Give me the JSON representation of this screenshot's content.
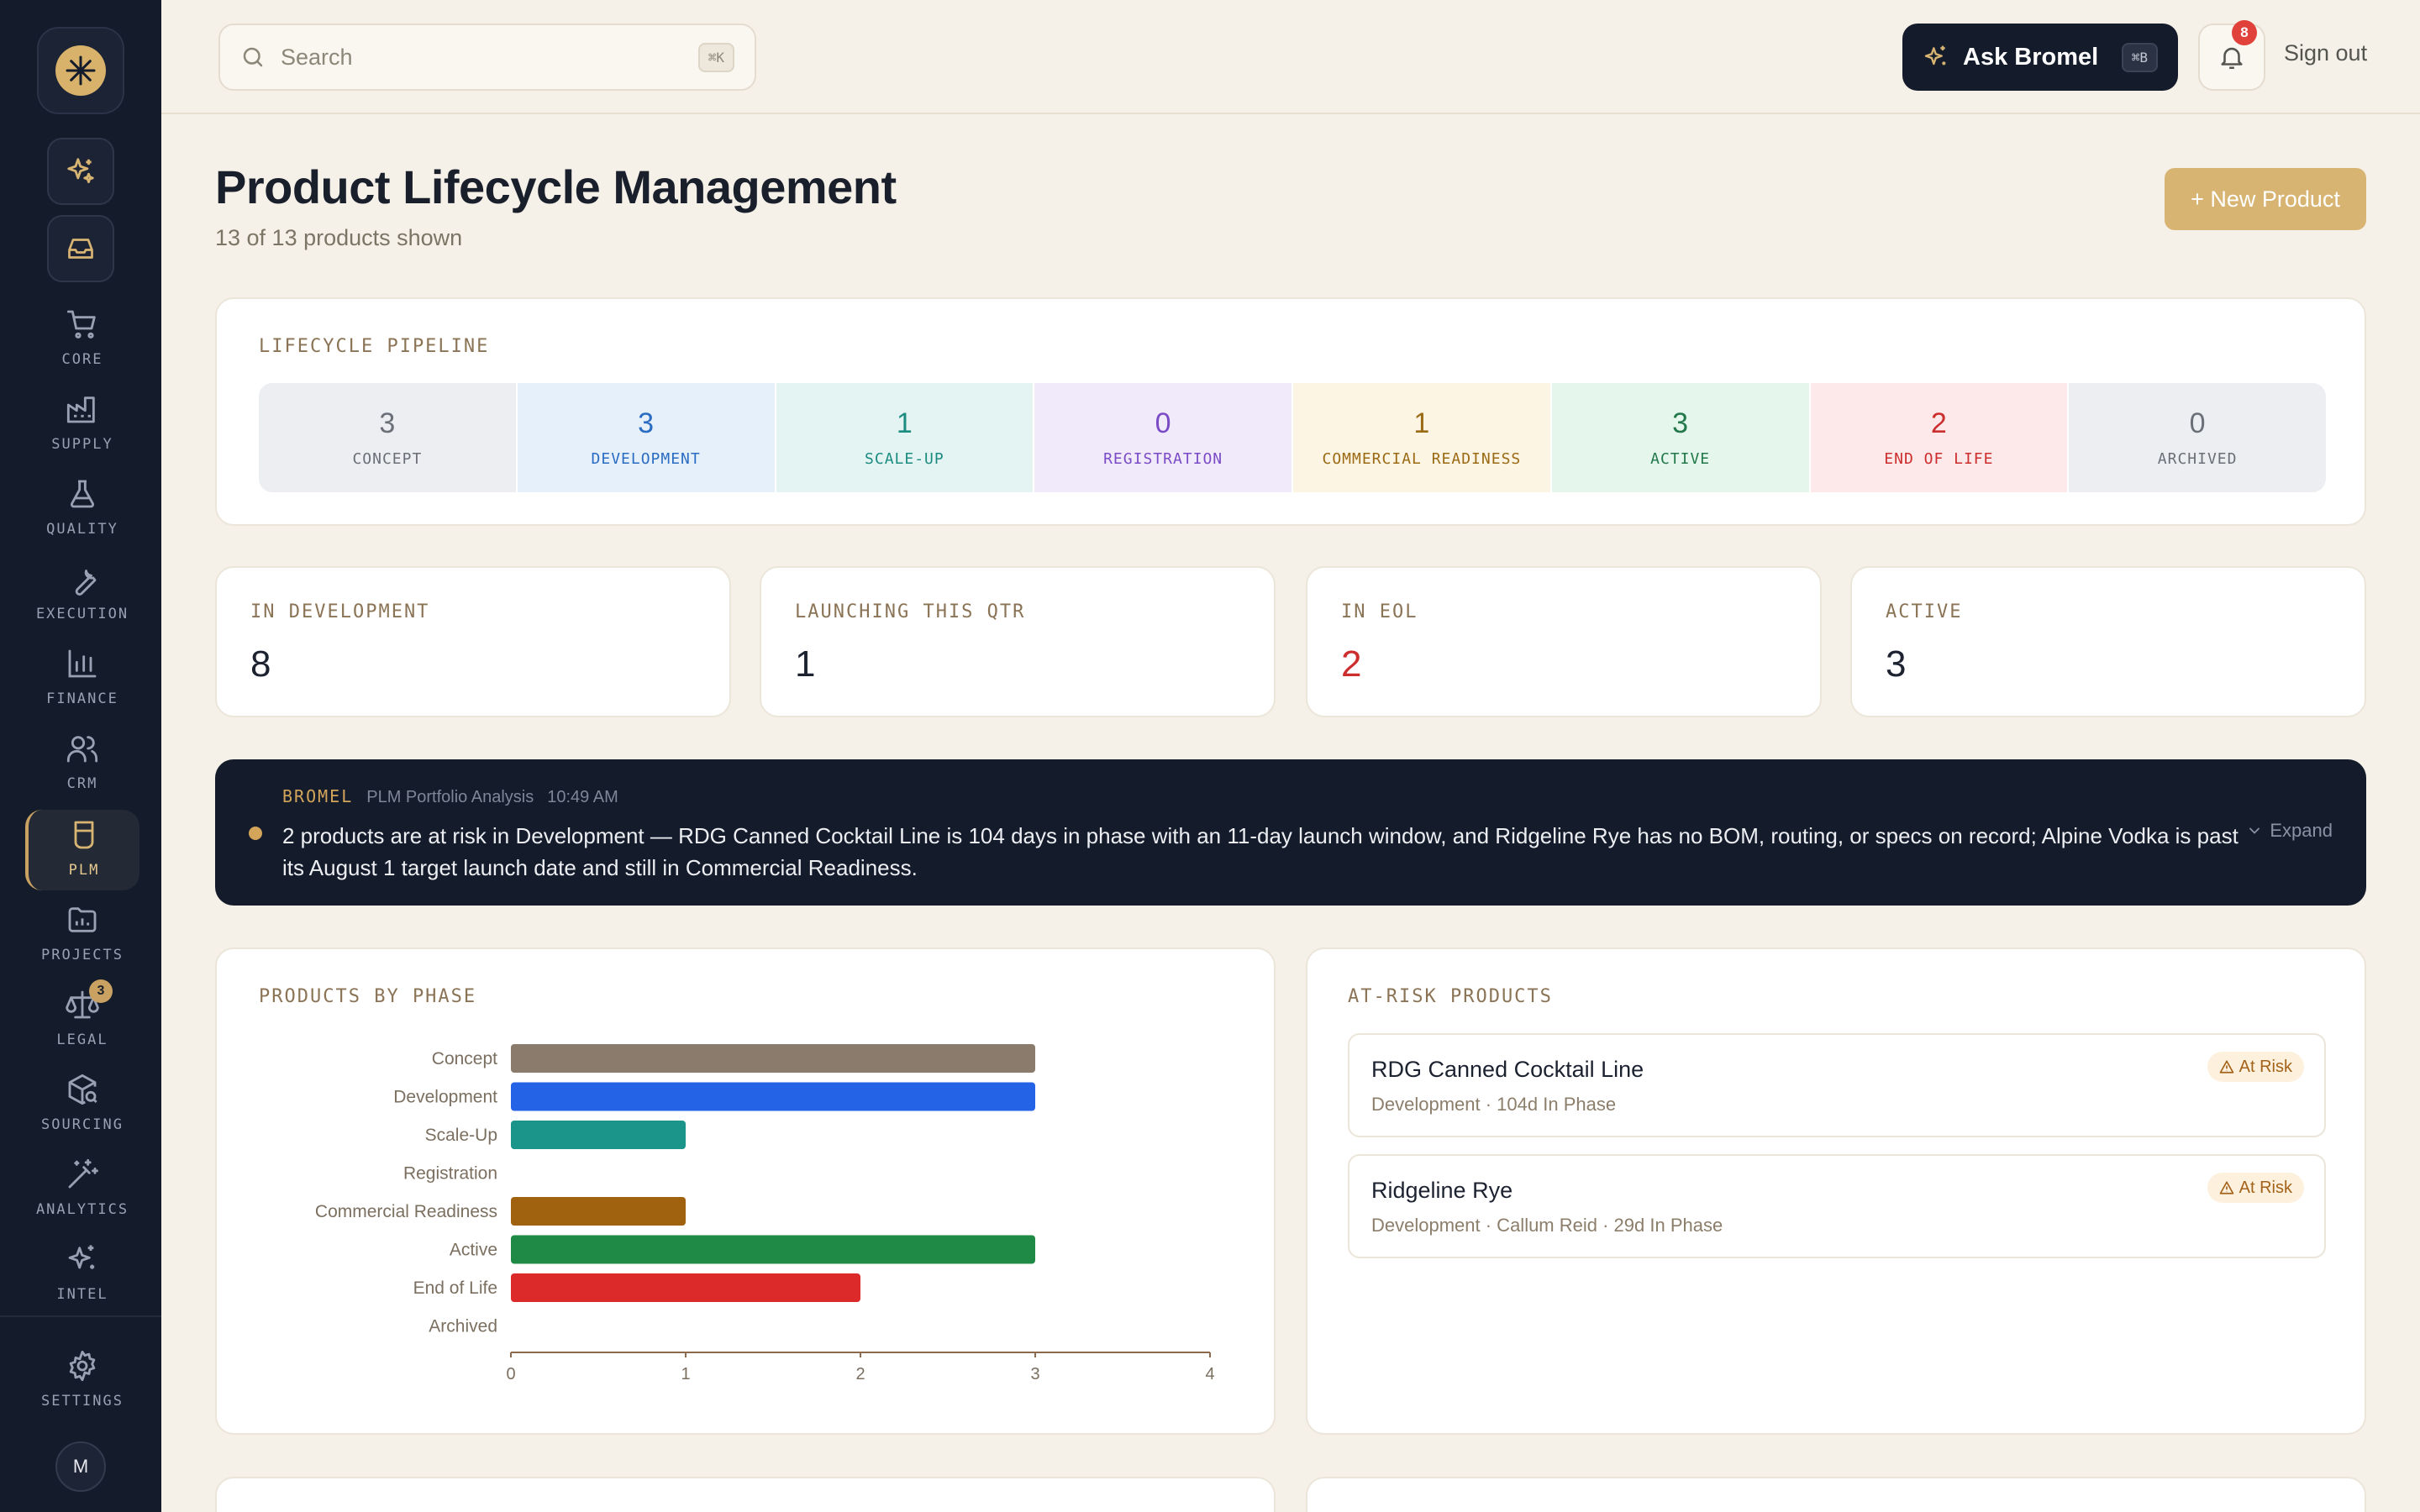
{
  "sidebar": {
    "items": [
      {
        "label": "CORE",
        "icon": "cart-icon"
      },
      {
        "label": "SUPPLY",
        "icon": "factory-icon"
      },
      {
        "label": "QUALITY",
        "icon": "flask-icon"
      },
      {
        "label": "EXECUTION",
        "icon": "wrench-icon"
      },
      {
        "label": "FINANCE",
        "icon": "bar-chart-icon"
      },
      {
        "label": "CRM",
        "icon": "users-icon"
      },
      {
        "label": "PLM",
        "icon": "cup-icon",
        "active": true
      },
      {
        "label": "PROJECTS",
        "icon": "folder-chart-icon"
      },
      {
        "label": "LEGAL",
        "icon": "scale-icon",
        "badge": "3"
      },
      {
        "label": "SOURCING",
        "icon": "package-search-icon"
      },
      {
        "label": "ANALYTICS",
        "icon": "wand-icon"
      },
      {
        "label": "INTEL",
        "icon": "sparkles-icon"
      }
    ],
    "settings_label": "SETTINGS",
    "avatar_initial": "M"
  },
  "topbar": {
    "search_placeholder": "Search",
    "search_shortcut": "⌘K",
    "ask_label": "Ask Bromel",
    "ask_shortcut": "⌘B",
    "notification_count": "8",
    "signout_label": "Sign out"
  },
  "page": {
    "title": "Product Lifecycle Management",
    "subtitle": "13 of 13 products shown",
    "new_button": "+ New Product"
  },
  "pipeline": {
    "label": "LIFECYCLE PIPELINE",
    "stages": [
      {
        "count": "3",
        "name": "CONCEPT",
        "bg": "#eceef1",
        "fg": "#6b6f78"
      },
      {
        "count": "3",
        "name": "DEVELOPMENT",
        "bg": "#e6f0fb",
        "fg": "#2a6cc2"
      },
      {
        "count": "1",
        "name": "SCALE-UP",
        "bg": "#e4f4f2",
        "fg": "#1c8b80"
      },
      {
        "count": "0",
        "name": "REGISTRATION",
        "bg": "#f1eafb",
        "fg": "#7a4bc4"
      },
      {
        "count": "1",
        "name": "COMMERCIAL READINESS",
        "bg": "#fdf5e3",
        "fg": "#9a6a14"
      },
      {
        "count": "3",
        "name": "ACTIVE",
        "bg": "#e5f6ec",
        "fg": "#22784a"
      },
      {
        "count": "2",
        "name": "END OF LIFE",
        "bg": "#fde9e9",
        "fg": "#cc2d2d"
      },
      {
        "count": "0",
        "name": "ARCHIVED",
        "bg": "#eceef1",
        "fg": "#6b6f78"
      }
    ]
  },
  "stats": [
    {
      "label": "IN DEVELOPMENT",
      "value": "8",
      "color": "#1d2230"
    },
    {
      "label": "LAUNCHING THIS QTR",
      "value": "1",
      "color": "#1d2230"
    },
    {
      "label": "IN EOL",
      "value": "2",
      "color": "#cc2d2d"
    },
    {
      "label": "ACTIVE",
      "value": "3",
      "color": "#1d2230"
    }
  ],
  "insight": {
    "source": "BROMEL",
    "topic": "PLM Portfolio Analysis",
    "time": "10:49 AM",
    "text": "2 products are at risk in Development — RDG Canned Cocktail Line is 104 days in phase with an 11-day launch window, and Ridgeline Rye has no BOM, routing, or specs on record; Alpine Vodka is past its August 1 target launch date and still in Commercial Readiness.",
    "expand_label": "Expand"
  },
  "products_by_phase": {
    "label": "PRODUCTS BY PHASE"
  },
  "chart_data": {
    "type": "bar",
    "orientation": "horizontal",
    "categories": [
      "Concept",
      "Development",
      "Scale-Up",
      "Registration",
      "Commercial Readiness",
      "Active",
      "End of Life",
      "Archived"
    ],
    "values": [
      3,
      3,
      1,
      0,
      1,
      3,
      2,
      0
    ],
    "colors": [
      "#8a7b6c",
      "#2563e6",
      "#1b948a",
      "#7a4bc4",
      "#a0620f",
      "#1f8a45",
      "#dc2a2a",
      "#8a8f99"
    ],
    "xlim": [
      0,
      4
    ],
    "xticks": [
      "0",
      "1",
      "2",
      "3",
      "4"
    ],
    "grid": false
  },
  "at_risk": {
    "label": "AT-RISK PRODUCTS",
    "items": [
      {
        "name": "RDG Canned Cocktail Line",
        "meta": "Development · 104d In Phase",
        "badge": "At Risk"
      },
      {
        "name": "Ridgeline Rye",
        "meta": "Development · Callum Reid · 29d In Phase",
        "badge": "At Risk"
      }
    ]
  },
  "colors": {
    "accent": "#d8b473",
    "sidebar_bg": "#141b2b",
    "page_bg": "#f5f0e8"
  }
}
